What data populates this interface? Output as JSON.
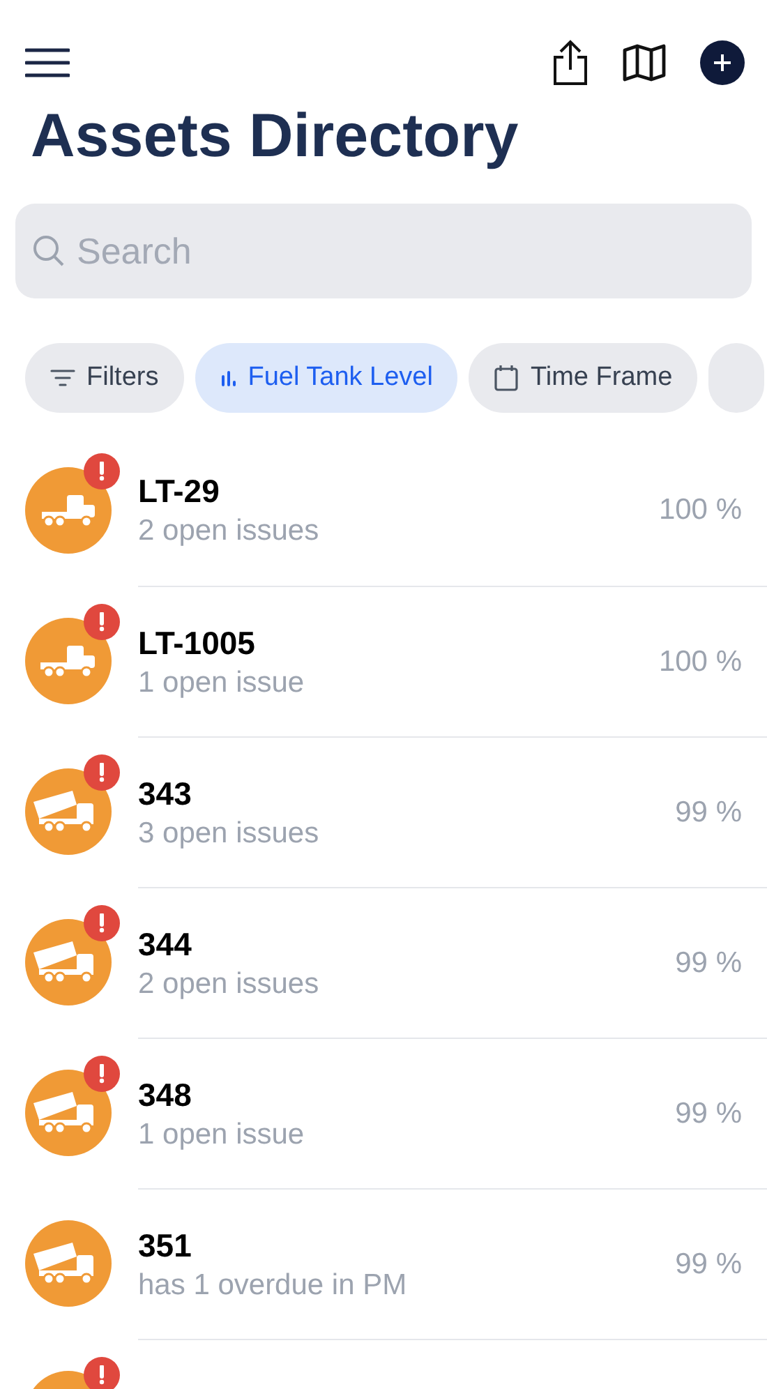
{
  "title": "Assets Directory",
  "search": {
    "placeholder": "Search"
  },
  "chips": [
    {
      "kind": "filters",
      "label": "Filters",
      "selected": false
    },
    {
      "kind": "level",
      "label": "Fuel Tank Level",
      "selected": true
    },
    {
      "kind": "time",
      "label": "Time Frame",
      "selected": false
    },
    {
      "kind": "more",
      "selected": false
    }
  ],
  "assets": [
    {
      "kind": "flatbed",
      "alert": true,
      "name": "LT-29",
      "status": "2 open issues",
      "reading": "100 %"
    },
    {
      "kind": "trailer",
      "alert": true,
      "name": "LT-1005",
      "status": "1 open issue",
      "reading": "100 %"
    },
    {
      "kind": "dump",
      "alert": true,
      "name": "343",
      "status": "3 open issues",
      "reading": "99 %"
    },
    {
      "kind": "dump",
      "alert": true,
      "name": "344",
      "status": "2 open issues",
      "reading": "99 %"
    },
    {
      "kind": "dump",
      "alert": true,
      "name": "348",
      "status": "1 open issue",
      "reading": "99 %"
    },
    {
      "kind": "dump",
      "alert": false,
      "name": "351",
      "status": "has 1 overdue in PM",
      "reading": "99 %"
    },
    {
      "alert": true
    }
  ]
}
